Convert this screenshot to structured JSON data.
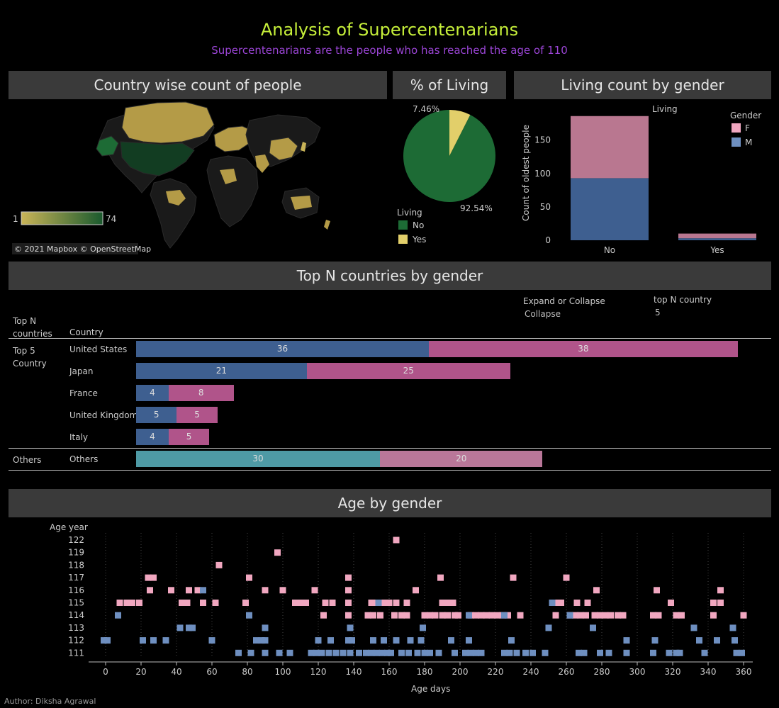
{
  "header": {
    "title": "Analysis of Supercentenarians",
    "subtitle": "Supercentenarians are the people who has reached the age of 110",
    "title_color": "#c6ef3a",
    "subtitle_color": "#9b45d6"
  },
  "map_panel": {
    "title": "Country wise count of people",
    "legend_min": "1",
    "legend_max": "74",
    "attribution": "© 2021 Mapbox © OpenStreetMap",
    "colors": {
      "low": "#c9b458",
      "high": "#1a5a2e"
    }
  },
  "pie_panel": {
    "title": "% of Living",
    "legend_title": "Living",
    "legend_items": [
      {
        "label": "No",
        "color": "#1d6b35"
      },
      {
        "label": "Yes",
        "color": "#e2cf6a"
      }
    ]
  },
  "gender_panel": {
    "title": "Living count by gender",
    "column_label": "Living",
    "legend_title": "Gender",
    "legend_items": [
      {
        "label": "F",
        "color": "#f1a7c0"
      },
      {
        "label": "M",
        "color": "#6e8fc0"
      }
    ]
  },
  "topn_panel": {
    "title": "Top N countries by gender",
    "expand_label": "Expand or Collapse",
    "expand_value": "Collapse",
    "topn_label": "top N country",
    "topn_value": "5",
    "col_group_header": "Top N\ncountries",
    "col_country_header": "Country",
    "group_top": "Top 5\nCountry",
    "group_others": "Others"
  },
  "scatter_panel": {
    "title": "Age by gender",
    "y_title": "Age year",
    "x_title": "Age days"
  },
  "footer": {
    "author": "Author: Diksha Agrawal"
  },
  "chart_data": [
    {
      "type": "pie",
      "name": "pct_living",
      "slices": [
        {
          "label": "No",
          "value": 92.54,
          "text": "92.54%",
          "color": "#1d6b35"
        },
        {
          "label": "Yes",
          "value": 7.46,
          "text": "7.46%",
          "color": "#e2cf6a"
        }
      ]
    },
    {
      "type": "bar",
      "name": "living_by_gender",
      "stacked": true,
      "categories": [
        "No",
        "Yes"
      ],
      "series": [
        {
          "name": "M",
          "values": [
            93,
            3
          ],
          "color": "#3e5f90"
        },
        {
          "name": "F",
          "values": [
            93,
            7
          ],
          "color": "#b97790"
        }
      ],
      "xlabel": "Living",
      "ylabel": "Count of oldest people",
      "yticks": [
        0,
        50,
        100,
        150
      ],
      "ylim": [
        0,
        190
      ],
      "grid": false
    },
    {
      "type": "bar",
      "name": "top_n_countries",
      "orientation": "horizontal",
      "stacked": true,
      "rows": [
        {
          "group": "Top 5",
          "country": "United States",
          "m": 36,
          "f": 38
        },
        {
          "group": "Top 5",
          "country": "Japan",
          "m": 21,
          "f": 25
        },
        {
          "group": "Top 5",
          "country": "France",
          "m": 4,
          "f": 8
        },
        {
          "group": "Top 5",
          "country": "United Kingdom",
          "m": 5,
          "f": 5
        },
        {
          "group": "Top 5",
          "country": "Italy",
          "m": 4,
          "f": 5
        },
        {
          "group": "Others",
          "country": "Others",
          "m": 30,
          "f": 20
        }
      ],
      "colors": {
        "m": "#3e5f90",
        "f": "#b0548a",
        "m_others": "#4e9aa5",
        "f_others": "#b97799"
      }
    },
    {
      "type": "scatter",
      "name": "age_by_gender",
      "xlabel": "Age days",
      "ylabel": "Age year",
      "xlim": [
        -10,
        365
      ],
      "xticks": [
        0,
        20,
        40,
        60,
        80,
        100,
        120,
        140,
        160,
        180,
        200,
        220,
        240,
        260,
        280,
        300,
        320,
        340,
        360
      ],
      "yticks": [
        111,
        112,
        113,
        114,
        115,
        116,
        117,
        118,
        119,
        122
      ],
      "colors": {
        "F": "#f1a7c0",
        "M": "#6e8fc0"
      },
      "points": {
        "F": {
          "122": [
            164
          ],
          "119": [
            97
          ],
          "118": [
            64
          ],
          "117": [
            24,
            27,
            81,
            137,
            189,
            230,
            260
          ],
          "116": [
            25,
            37,
            47,
            52,
            90,
            100,
            118,
            137,
            175,
            277,
            311,
            347
          ],
          "115": [
            8,
            12,
            15,
            19,
            43,
            46,
            55,
            62,
            79,
            107,
            110,
            113,
            124,
            128,
            137,
            150,
            153,
            157,
            160,
            164,
            170,
            190,
            193,
            196,
            255,
            257,
            266,
            272,
            319,
            343,
            347
          ],
          "114": [
            123,
            137,
            148,
            151,
            155,
            163,
            167,
            170,
            180,
            183,
            186,
            190,
            193,
            197,
            199,
            206,
            209,
            212,
            215,
            218,
            221,
            224,
            227,
            234,
            254,
            262,
            265,
            268,
            271,
            276,
            279,
            282,
            285,
            289,
            292,
            309,
            312,
            322,
            325,
            343,
            360
          ]
        },
        "M": {
          "116": [
            55
          ],
          "115": [
            154,
            252
          ],
          "114": [
            7,
            81,
            205,
            225,
            262
          ],
          "113": [
            42,
            47,
            49,
            90,
            138,
            179,
            250,
            275,
            332,
            354
          ],
          "112": [
            -1,
            1,
            21,
            27,
            34,
            60,
            85,
            88,
            90,
            120,
            127,
            137,
            139,
            151,
            157,
            164,
            172,
            178,
            195,
            205,
            229,
            294,
            310,
            335,
            345,
            355
          ],
          "111": [
            75,
            82,
            90,
            98,
            104,
            116,
            119,
            122,
            126,
            130,
            134,
            138,
            143,
            147,
            150,
            153,
            156,
            159,
            161,
            167,
            171,
            176,
            180,
            183,
            188,
            197,
            203,
            206,
            209,
            212,
            225,
            228,
            232,
            237,
            241,
            248,
            267,
            270,
            279,
            284,
            294,
            309,
            318,
            322,
            324,
            338,
            356,
            359
          ]
        }
      }
    }
  ]
}
